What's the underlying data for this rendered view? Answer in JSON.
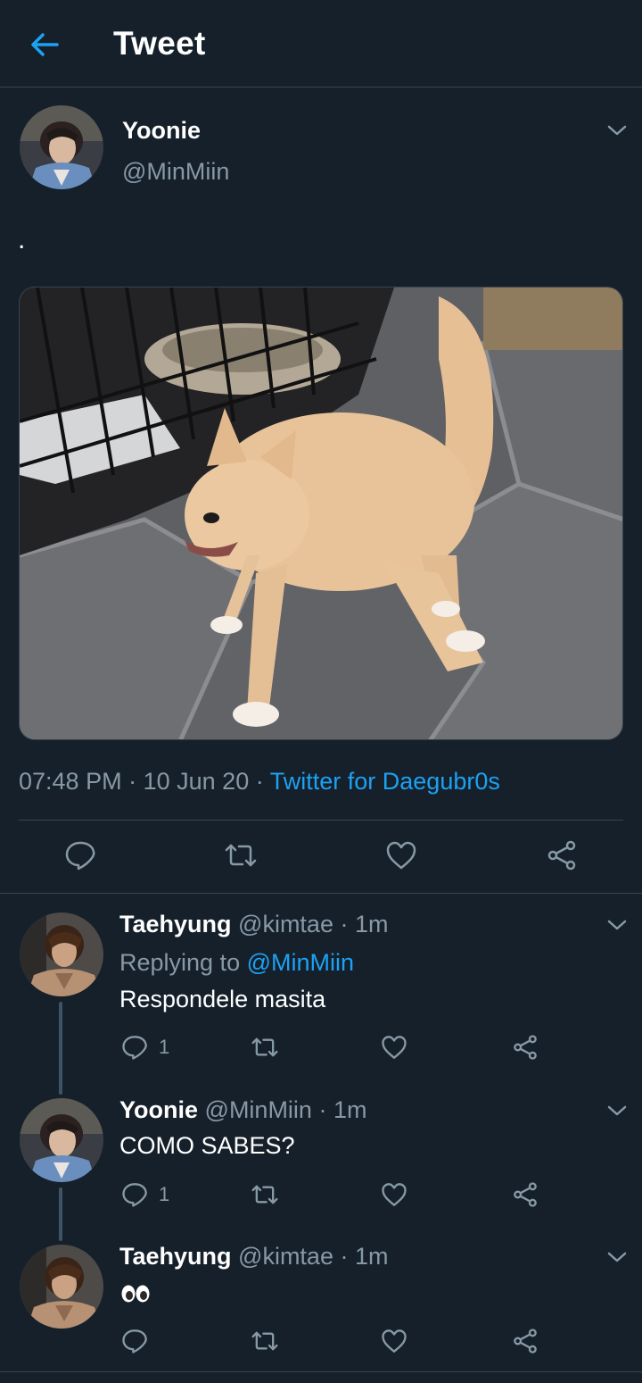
{
  "header": {
    "title": "Tweet"
  },
  "main_tweet": {
    "name": "Yoonie",
    "handle": "@MinMiin",
    "text": ".",
    "time": "07:48 PM",
    "date": "10 Jun 20",
    "source": "Twitter for Daegubr0s",
    "separator": "·"
  },
  "replies": [
    {
      "name": "Taehyung",
      "handle": "@kimtae",
      "time": "1m",
      "replying_prefix": "Replying to ",
      "replying_to": "@MinMiin",
      "text": "Respondele masita",
      "reply_count": "1"
    },
    {
      "name": "Yoonie",
      "handle": "@MinMiin",
      "time": "1m",
      "text": "COMO SABES?",
      "reply_count": "1"
    },
    {
      "name": "Taehyung",
      "handle": "@kimtae",
      "time": "1m",
      "text_emoji": "eyes-emoji"
    }
  ],
  "colors": {
    "background": "#15202b",
    "accent": "#1da1f2",
    "secondary_text": "#8899a6",
    "divider": "#38444d"
  },
  "icons": [
    "back-arrow-icon",
    "chevron-down-icon",
    "reply-icon",
    "retweet-icon",
    "like-icon",
    "share-icon"
  ]
}
